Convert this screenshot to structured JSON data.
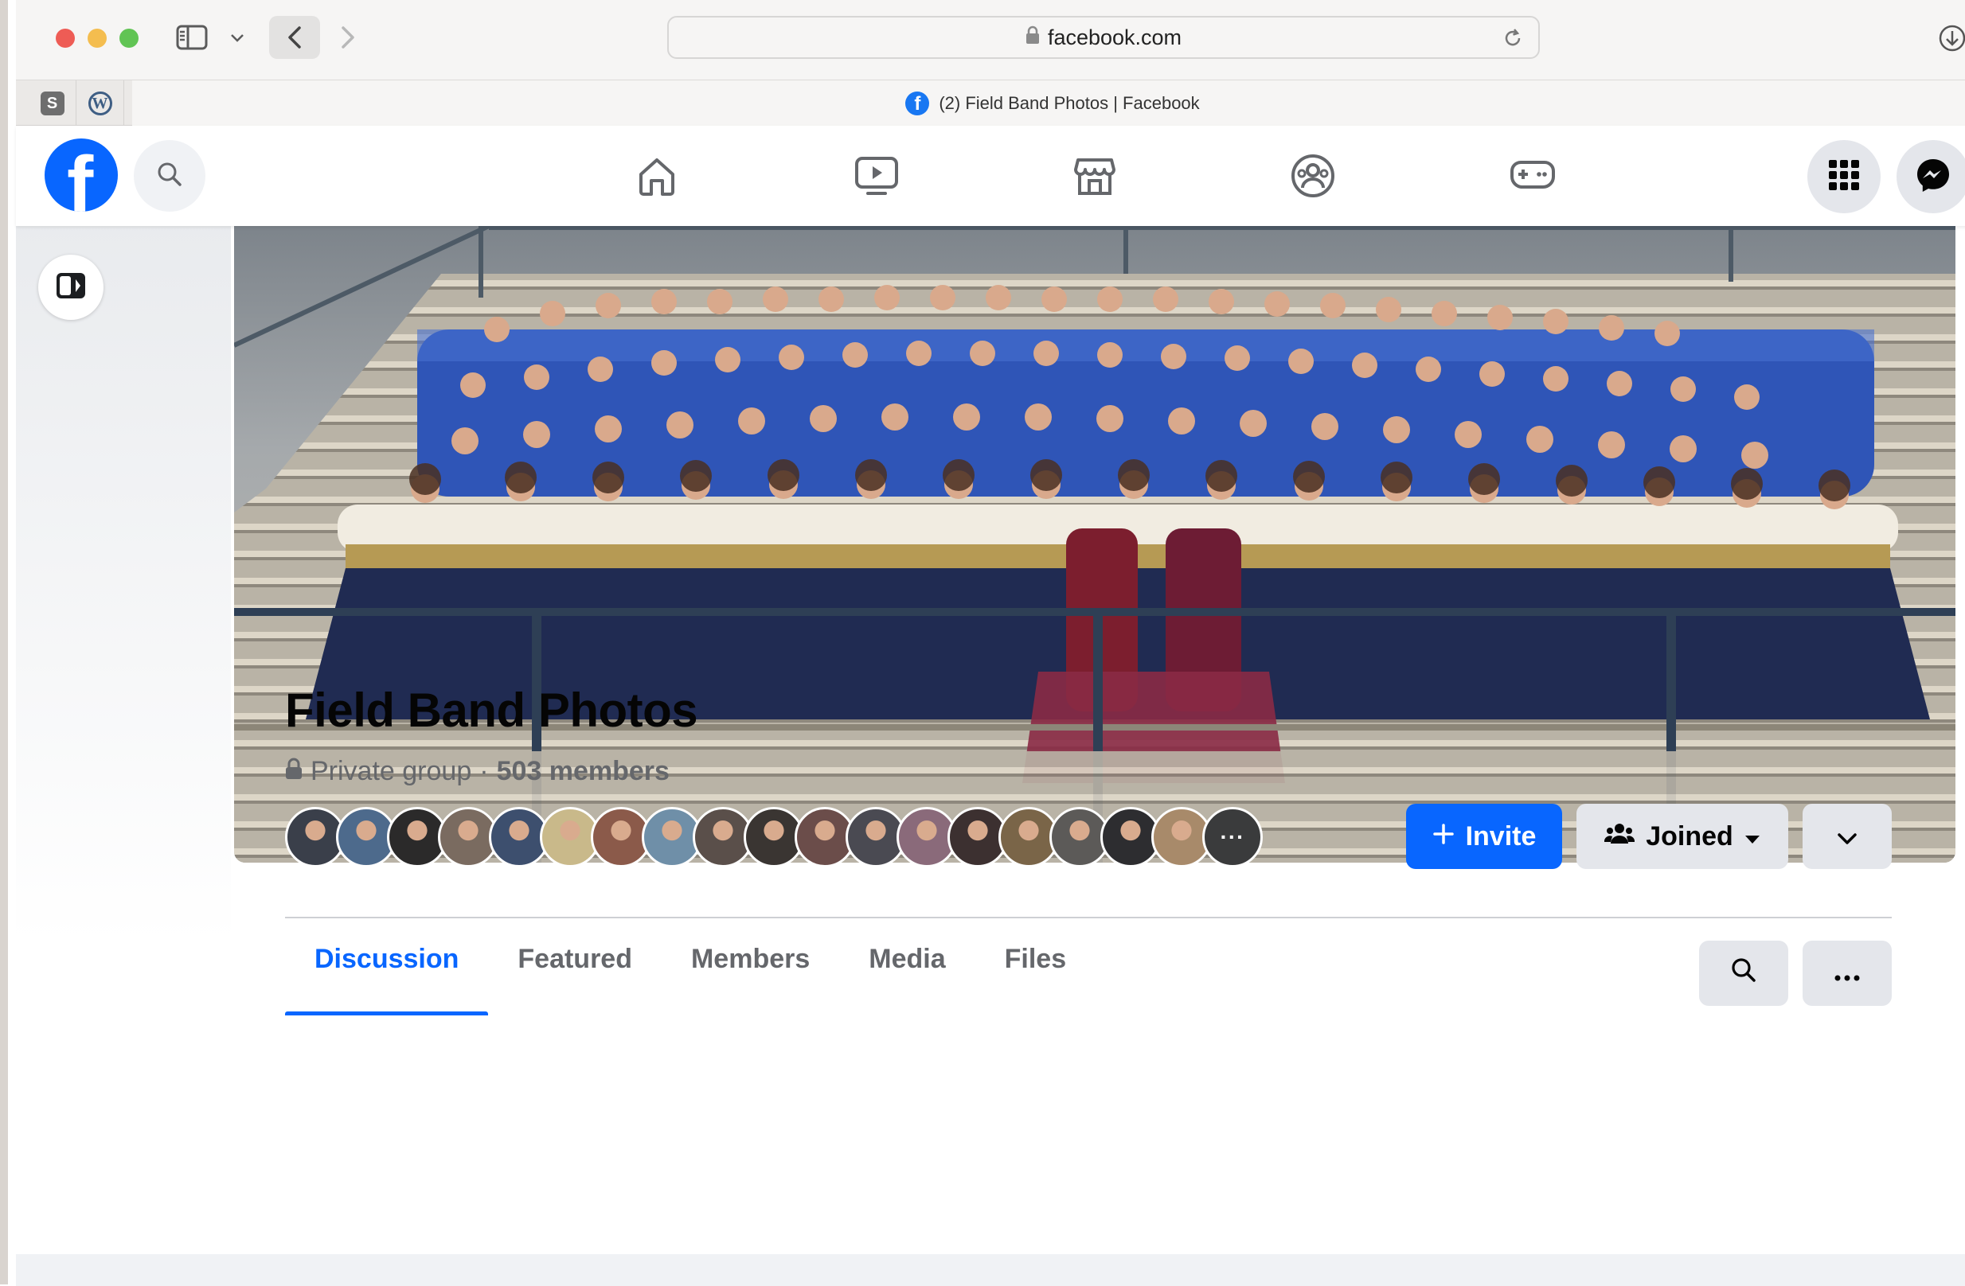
{
  "browser": {
    "url": "facebook.com",
    "tab_title": "(2) Field Band Photos | Facebook",
    "pinned_tabs": [
      {
        "label": "S",
        "icon": "s-app-icon"
      },
      {
        "label": "W",
        "icon": "wordpress-icon"
      }
    ]
  },
  "fb_nav": {
    "logo": "f",
    "items": [
      "home-icon",
      "video-icon",
      "marketplace-icon",
      "groups-icon",
      "gaming-icon"
    ],
    "active_item": "none"
  },
  "group": {
    "name": "Field Band Photos",
    "privacy": "Private group",
    "separator": "·",
    "members": "503 members",
    "more_avatars": "···",
    "avatar_colors": [
      "#3a3f4a",
      "#4d6a8c",
      "#2b2a2a",
      "#7a6b60",
      "#3d4f6e",
      "#c9b98a",
      "#8b5a4a",
      "#6f8fa8",
      "#5a4f4a",
      "#3a3532",
      "#6b4d4a",
      "#4a4a52",
      "#8a6a7a",
      "#3c3030",
      "#7a6548",
      "#5c5a58",
      "#2d2d30",
      "#a88a6a"
    ]
  },
  "actions": {
    "invite": "Invite",
    "joined": "Joined"
  },
  "tabs": {
    "items": [
      "Discussion",
      "Featured",
      "Members",
      "Media",
      "Files"
    ],
    "active": "Discussion"
  },
  "colors": {
    "fb_blue": "#0866ff",
    "text_primary": "#050505",
    "text_secondary": "#65676b",
    "button_gray": "#e4e6eb"
  }
}
